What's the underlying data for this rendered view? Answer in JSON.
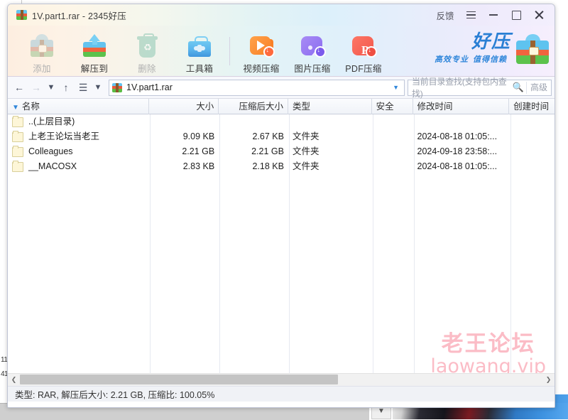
{
  "window": {
    "title": "1V.part1.rar - 2345好压",
    "title_icon": "archive-icon",
    "feedback_label": "反馈",
    "menu_icon": "hamburger-menu-icon",
    "minimize_icon": "minimize-icon",
    "maximize_icon": "maximize-icon",
    "close_icon": "close-icon"
  },
  "toolbar": {
    "buttons": [
      {
        "label": "添加",
        "icon": "add-archive-icon",
        "disabled": true
      },
      {
        "label": "解压到",
        "icon": "extract-to-icon",
        "disabled": false
      },
      {
        "label": "删除",
        "icon": "delete-trash-icon",
        "disabled": true
      },
      {
        "label": "工具箱",
        "icon": "toolbox-icon",
        "disabled": false
      },
      {
        "label": "视频压缩",
        "icon": "video-compress-icon",
        "disabled": false
      },
      {
        "label": "图片压缩",
        "icon": "image-compress-icon",
        "disabled": false
      },
      {
        "label": "PDF压缩",
        "icon": "pdf-compress-icon",
        "disabled": false
      }
    ],
    "brand": {
      "name": "好压",
      "tagline_1": "高效专业",
      "tagline_2": "值得信赖",
      "logo_icon": "haoya-archive-logo",
      "color": "#2a7fd4"
    }
  },
  "navbar": {
    "back_icon": "arrow-left-icon",
    "forward_icon": "arrow-right-icon",
    "history_icon": "chevron-down-icon",
    "up_icon": "arrow-up-icon",
    "view_icon": "list-view-icon",
    "view_chevron_icon": "chevron-down-icon",
    "address_icon": "rar-file-icon",
    "address_value": "1V.part1.rar",
    "address_caret_icon": "chevron-down-icon",
    "search_placeholder": "当前目录查找(支持包内查找)",
    "search_icon": "search-icon",
    "advanced_label": "高级"
  },
  "columns": [
    {
      "key": "name",
      "label": "名称",
      "sort_icon": "sort-ascending-arrow"
    },
    {
      "key": "size",
      "label": "大小"
    },
    {
      "key": "packed",
      "label": "压缩后大小"
    },
    {
      "key": "type",
      "label": "类型"
    },
    {
      "key": "security",
      "label": "安全"
    },
    {
      "key": "modified",
      "label": "修改时间"
    },
    {
      "key": "created",
      "label": "创建时间"
    }
  ],
  "rows": [
    {
      "icon": "folder-icon",
      "name": "..(上层目录)",
      "size": "",
      "packed": "",
      "type": "",
      "security": "",
      "modified": "",
      "created": ""
    },
    {
      "icon": "folder-icon",
      "name": "上老王论坛当老王",
      "size": "9.09 KB",
      "packed": "2.67 KB",
      "type": "文件夹",
      "security": "",
      "modified": "2024-08-18 01:05:...",
      "created": ""
    },
    {
      "icon": "folder-icon",
      "name": "Colleagues",
      "size": "2.21 GB",
      "packed": "2.21 GB",
      "type": "文件夹",
      "security": "",
      "modified": "2024-09-18 23:58:...",
      "created": ""
    },
    {
      "icon": "folder-icon",
      "name": "__MACOSX",
      "size": "2.83 KB",
      "packed": "2.18 KB",
      "type": "文件夹",
      "security": "",
      "modified": "2024-08-18 01:05:...",
      "created": ""
    }
  ],
  "watermark": {
    "line1": "老王论坛",
    "line2": "laowang.vip",
    "color": "#fbbcc6"
  },
  "scrollbar": {
    "left_icon": "chevron-left-icon",
    "right_icon": "chevron-right-icon"
  },
  "statusbar": {
    "text": "类型: RAR, 解压后大小: 2.21 GB, 压缩比: 100.05%"
  },
  "background": {
    "line_number_1": "11",
    "line_number_2": "41",
    "scroll_down_icon": "chevron-down-icon"
  }
}
